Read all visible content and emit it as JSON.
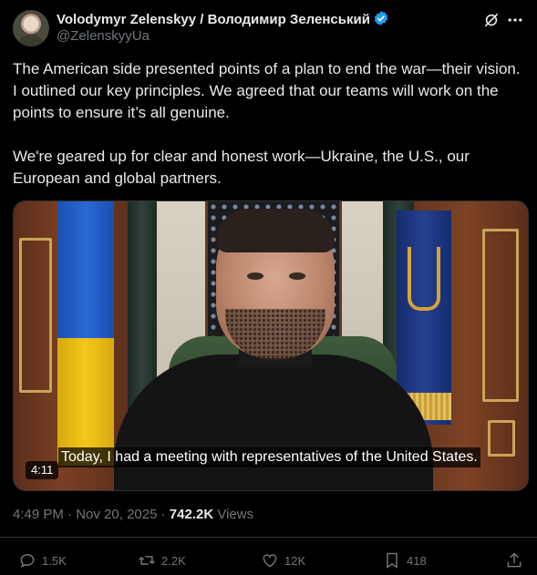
{
  "author": {
    "name": "Volodymyr Zelenskyy / Володимир Зеленський",
    "handle": "@ZelenskyyUa",
    "verified": true,
    "verified_color": "#1d9bf0"
  },
  "tweet": {
    "paragraph1": "The American side presented points of a plan to end the war—their vision. I outlined our key principles. We agreed that our teams will work on the points to ensure it’s all genuine.",
    "paragraph2": "We're geared up for clear and honest work—Ukraine, the U.S., our European and global partners."
  },
  "video": {
    "subtitle": "Today, I had a meeting with representatives of the United States.",
    "duration": "4:11"
  },
  "meta": {
    "time": "4:49 PM",
    "separator1": " · ",
    "date": "Nov 20, 2025",
    "separator2": " · ",
    "views_count": "742.2K",
    "views_label": " Views"
  },
  "actions": {
    "replies": "1.5K",
    "reposts": "2.2K",
    "likes": "12K",
    "bookmarks": "418"
  },
  "icons": {
    "grok": "grok-icon",
    "more": "more-icon",
    "reply": "reply-icon",
    "repost": "repost-icon",
    "like": "heart-icon",
    "bookmark": "bookmark-icon",
    "share": "share-icon"
  },
  "colors": {
    "background": "#000000",
    "text": "#e7e9ea",
    "muted": "#71767b",
    "divider": "#2f3336"
  }
}
